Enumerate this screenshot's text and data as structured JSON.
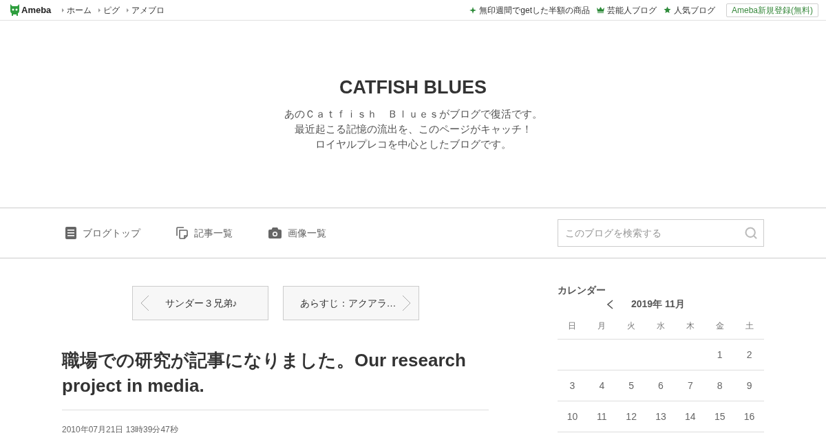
{
  "top_bar": {
    "logo": "Ameba",
    "links": [
      {
        "label": "ホーム"
      },
      {
        "label": "ピグ"
      },
      {
        "label": "アメブロ"
      }
    ],
    "promo_links": [
      {
        "kind": "sparkle",
        "label": "無印週間でgetした半額の商品"
      },
      {
        "kind": "crown",
        "label": "芸能人ブログ"
      },
      {
        "kind": "star",
        "label": "人気ブログ"
      }
    ],
    "signup_button": "Ameba新規登録(無料)"
  },
  "header": {
    "title": "CATFISH BLUES",
    "description": [
      "あのＣａｔｆｉｓｈ　Ｂｌｕｅｓがブログで復活です。",
      "最近起こる記憶の流出を、このページがキャッチ！",
      "ロイヤルプレコを中心としたブログです。"
    ]
  },
  "blog_nav": {
    "items": [
      {
        "kind": "document",
        "label": "ブログトップ"
      },
      {
        "kind": "pages",
        "label": "記事一覧"
      },
      {
        "kind": "camera",
        "label": "画像一覧"
      }
    ],
    "search": {
      "placeholder": "このブログを検索する"
    }
  },
  "pager": {
    "previous": "サンダー３兄弟♪",
    "next": "あらすじ：アクアラ…"
  },
  "article": {
    "title": "職場での研究が記事になりました。Our research project in media.",
    "date": "2010年07月21日 13時39分47秒"
  },
  "calendar": {
    "heading": "カレンダー",
    "month": "2019年 11月",
    "weekdays": [
      "日",
      "月",
      "火",
      "水",
      "木",
      "金",
      "土"
    ],
    "weeks": [
      {
        "pad_start": true,
        "days": [
          "1",
          "2"
        ]
      },
      {
        "days": [
          "3",
          "4",
          "5",
          "6",
          "7",
          "8",
          "9"
        ]
      },
      {
        "days": [
          "10",
          "11",
          "12",
          "13",
          "14",
          "15",
          "16"
        ]
      }
    ]
  }
}
